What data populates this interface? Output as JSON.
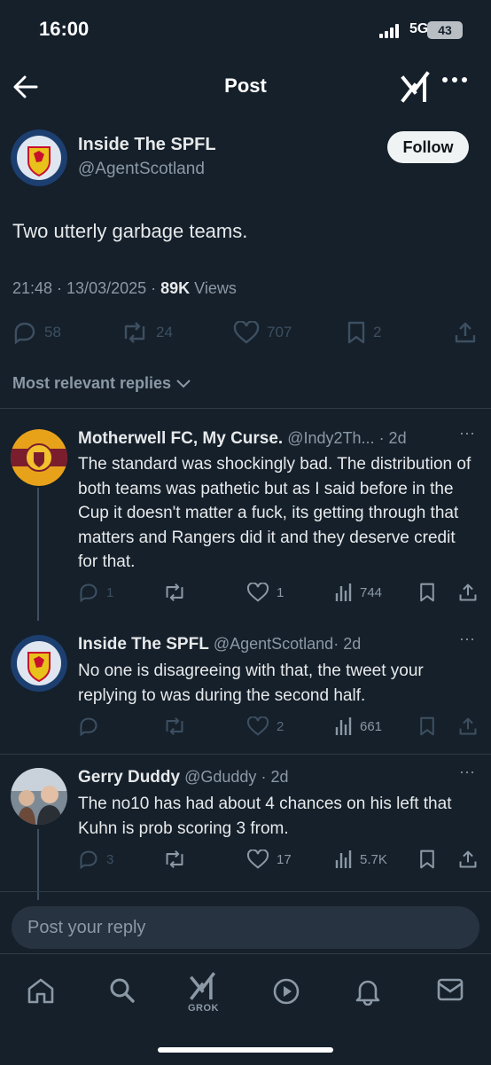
{
  "status_bar": {
    "time": "16:00",
    "network": "5G",
    "battery": "43"
  },
  "nav": {
    "title": "Post"
  },
  "post": {
    "author_name": "Inside The SPFL",
    "author_handle": "@AgentScotland",
    "follow_label": "Follow",
    "text": "Two utterly garbage teams.",
    "timestamp": "21:48 · 13/03/2025 · ",
    "views_count": "89K",
    "views_label": " Views",
    "replies": "58",
    "reposts": "24",
    "likes": "707",
    "bookmarks": "2"
  },
  "replies_filter": "Most relevant replies",
  "replies": [
    {
      "name": "Motherwell FC, My Curse.",
      "handle": "@Indy2Th...",
      "time": "· 2d",
      "text": "The standard was shockingly bad. The distribution of both teams was pathetic but as I said before in the Cup it doesn't matter a fuck, its getting through that matters and Rangers did it and they deserve credit for that.",
      "replies": "1",
      "likes": "1",
      "views": "744"
    },
    {
      "name": "Inside The SPFL",
      "handle": "@AgentScotland",
      "time": "· 2d",
      "text": "No one is disagreeing with that, the tweet your replying to was during the second half.",
      "replies": "",
      "likes": "2",
      "views": "661"
    },
    {
      "name": "Gerry Duddy",
      "handle": "@Gduddy",
      "time": "· 2d",
      "text": "The no10 has had about 4 chances on his left that Kuhn is prob scoring 3 from.",
      "replies": "3",
      "likes": "17",
      "views": "5.7K"
    }
  ],
  "reply_box": {
    "placeholder": "Post your reply"
  },
  "bottom_nav": {
    "grok_label": "GROK"
  },
  "colors": {
    "background": "#15202b",
    "text": "#e7e9ea",
    "muted": "#8b98a5"
  }
}
